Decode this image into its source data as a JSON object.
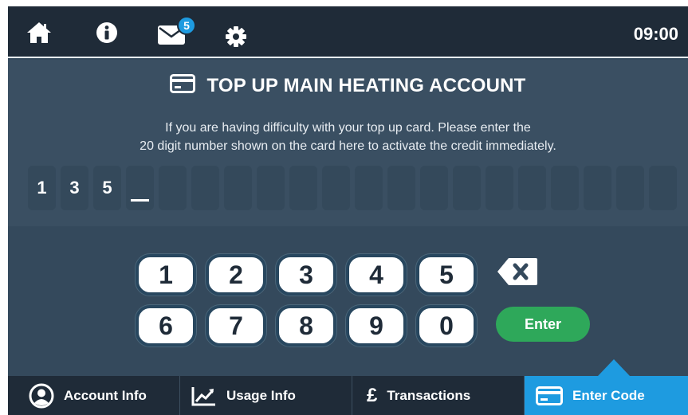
{
  "topbar": {
    "icons": [
      "home-icon",
      "info-icon",
      "mail-icon",
      "gear-icon"
    ],
    "mail_badge": "5",
    "clock": "09:00"
  },
  "panel": {
    "title": "TOP UP MAIN HEATING ACCOUNT",
    "title_icon": "card-icon",
    "description_line1": "If you are having difficulty with your top up card. Please enter the",
    "description_line2": "20 digit number shown on the card here to activate the credit immediately.",
    "entered_digits": [
      "1",
      "3",
      "5"
    ],
    "total_digits": 20
  },
  "keypad": {
    "row1": [
      "1",
      "2",
      "3",
      "4",
      "5"
    ],
    "row2": [
      "6",
      "7",
      "8",
      "9",
      "0"
    ],
    "backspace_icon": "backspace-icon",
    "enter_label": "Enter"
  },
  "bottom_nav": {
    "items": [
      {
        "label": "Account Info",
        "icon": "user-icon"
      },
      {
        "label": "Usage Info",
        "icon": "chart-icon"
      },
      {
        "label": "Transactions",
        "icon": "pound-icon",
        "glyph": "£"
      },
      {
        "label": "Enter Code",
        "icon": "card-icon"
      }
    ],
    "active_index": 3
  },
  "colors": {
    "topbar": "#1f2b38",
    "panel": "#34495c",
    "accent": "#1e9be0",
    "enter": "#2ea85a"
  }
}
